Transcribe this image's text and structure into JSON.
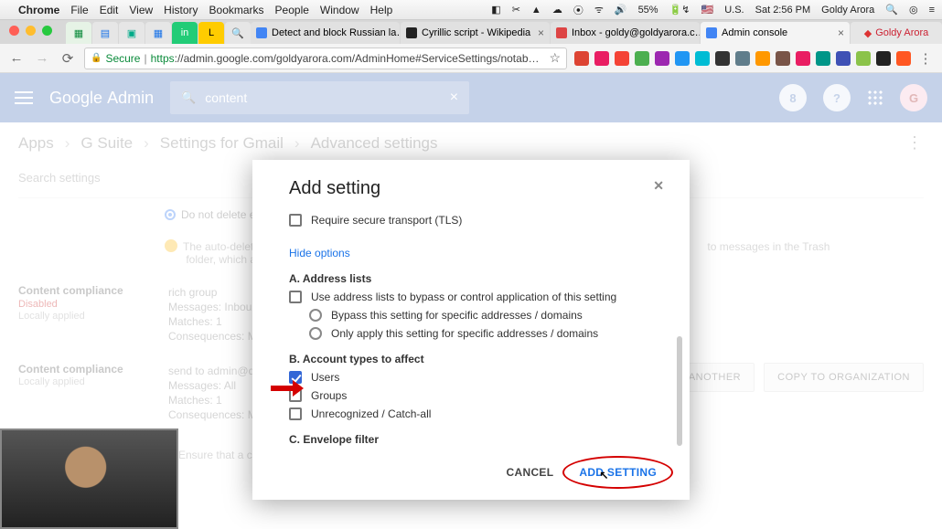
{
  "menubar": {
    "app": "Chrome",
    "items": [
      "File",
      "Edit",
      "View",
      "History",
      "Bookmarks",
      "People",
      "Window",
      "Help"
    ],
    "right": {
      "battery": "55%",
      "locale": "U.S.",
      "time": "Sat 2:56 PM",
      "user": "Goldy Arora"
    }
  },
  "tabs": {
    "pinned_count": 7,
    "list": [
      {
        "label": "Detect and block Russian la…",
        "active": false
      },
      {
        "label": "Cyrillic script - Wikipedia",
        "active": false
      },
      {
        "label": "Inbox - goldy@goldyarora.c…",
        "active": false
      },
      {
        "label": "Admin console",
        "active": true
      }
    ],
    "ext_tab": "Goldy Arora"
  },
  "addressbar": {
    "secure": "Secure",
    "url": "https://admin.google.com/goldyarora.com/AdminHome#ServiceSettings/notab=1&se…"
  },
  "gahead": {
    "logo1": "Google",
    "logo2": "Admin",
    "search_value": "content",
    "badge": "8",
    "help": "?",
    "avatar": "G"
  },
  "breadcrumb": [
    "Apps",
    "G Suite",
    "Settings for Gmail",
    "Advanced settings"
  ],
  "content": {
    "search_placeholder": "Search settings",
    "radio_label": "Do not delete em",
    "warn_text": "The auto-deletion … to messages in the Trash folder, which are …",
    "cc1": {
      "title": "Content compliance",
      "state": "Disabled",
      "la": "Locally applied",
      "desc": "rich group",
      "msgs": "Messages:  Inbound",
      "matches": "Matches:  1",
      "cons": "Consequences:  Mod"
    },
    "cc2": {
      "title": "Content compliance",
      "la": "Locally applied",
      "desc": "send to admin@demo",
      "msgs": "Messages:  All",
      "matches": "Matches:  1",
      "cons": "Consequences:  Mod"
    },
    "ensure": "Ensure that a cop",
    "btn_another": "ANOTHER",
    "btn_copy": "COPY TO ORGANIZATION"
  },
  "modal": {
    "title": "Add setting",
    "tls": "Require secure transport (TLS)",
    "hide": "Hide options",
    "secA": "A. Address lists",
    "a1": "Use address lists to bypass or control application of this setting",
    "a2": "Bypass this setting for specific addresses / domains",
    "a3": "Only apply this setting for specific addresses / domains",
    "secB": "B. Account types to affect",
    "b1": "Users",
    "b2": "Groups",
    "b3": "Unrecognized / Catch-all",
    "secC": "C. Envelope filter",
    "cancel": "CANCEL",
    "add": "ADD SETTING"
  }
}
